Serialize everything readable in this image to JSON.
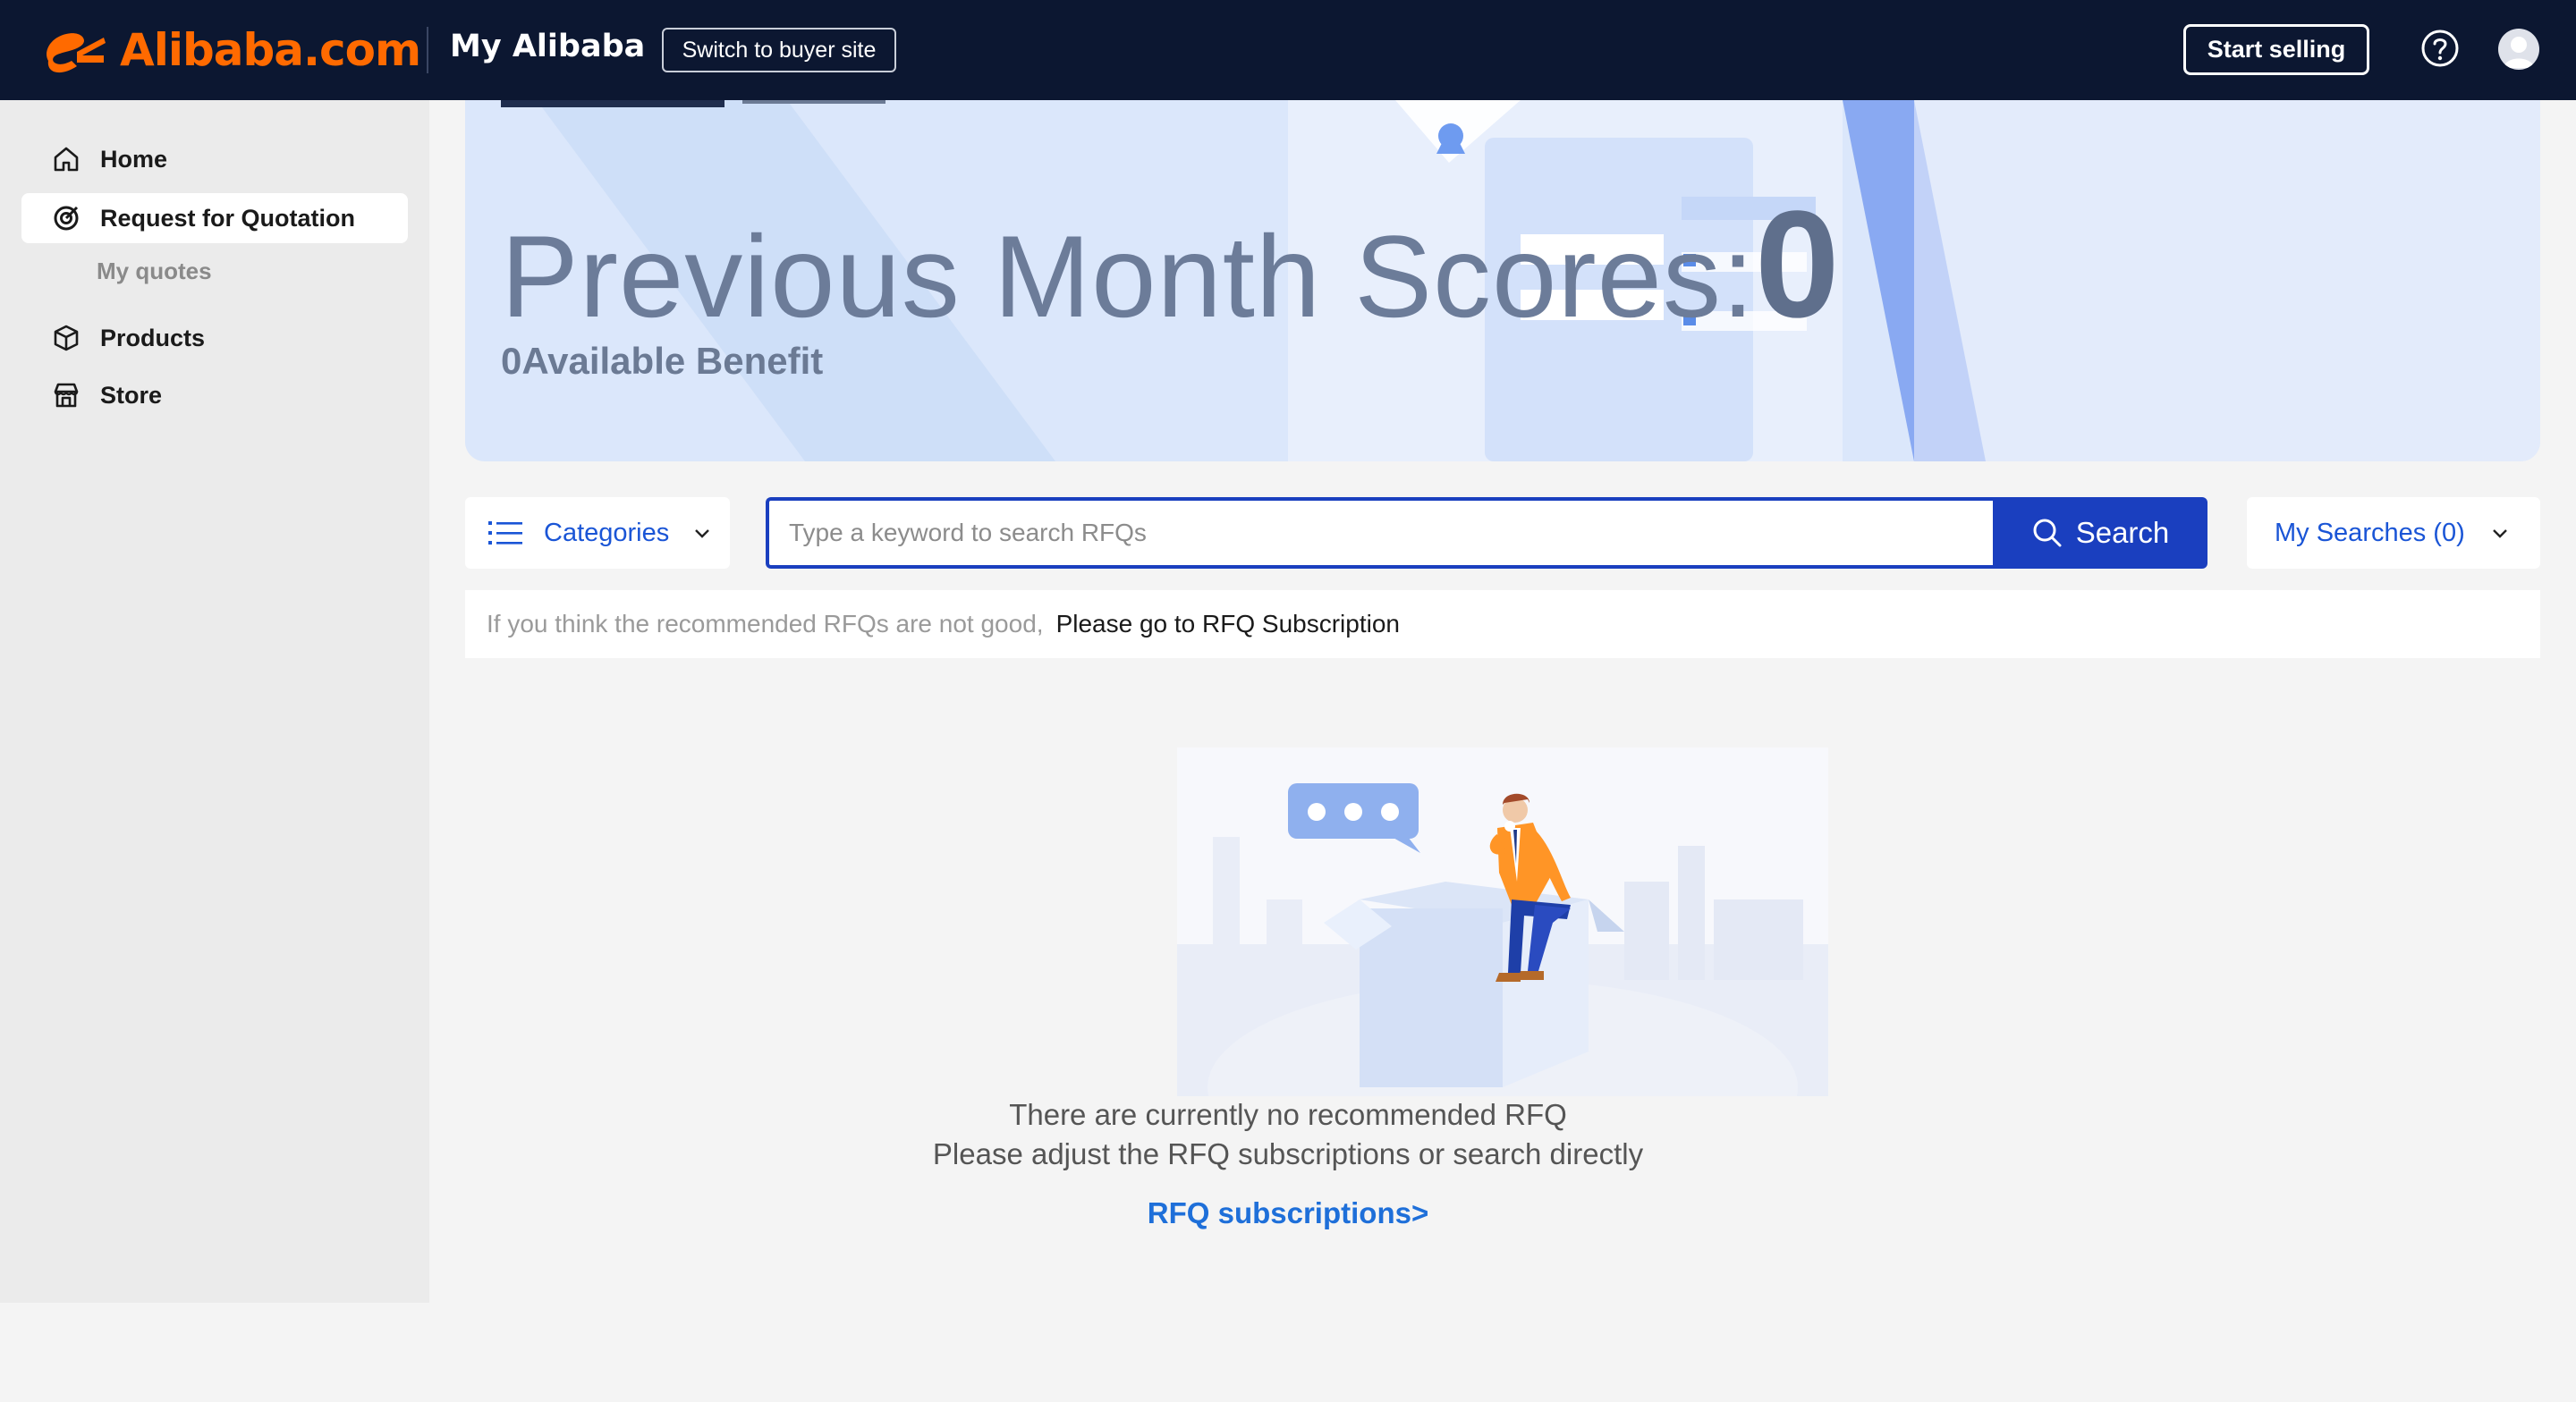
{
  "header": {
    "logo_text": "Alibaba.com",
    "title": "My Alibaba",
    "switch_label": "Switch to buyer site",
    "start_selling_label": "Start selling",
    "icons": [
      "alibaba-logo",
      "help-icon",
      "user-avatar"
    ]
  },
  "sidebar": {
    "items": [
      {
        "label": "Home",
        "icon": "home-icon"
      },
      {
        "label": "Request for Quotation",
        "icon": "target-icon",
        "active": true
      },
      {
        "label": "Products",
        "icon": "box-icon"
      },
      {
        "label": "Store",
        "icon": "store-icon"
      }
    ],
    "sub_item": "My quotes"
  },
  "banner": {
    "title": "Previous Month Scores:",
    "score": "0",
    "benefit": "0Available Benefit"
  },
  "search": {
    "categories_label": "Categories",
    "placeholder": "Type a keyword to search RFQs",
    "button_label": "Search",
    "my_searches_label": "My Searches (0)"
  },
  "hint": {
    "text": "If you think the recommended RFQs are not good,",
    "link": "Please go to RFQ Subscription"
  },
  "empty_state": {
    "line1": "There are currently no recommended RFQ",
    "line2": "Please adjust the RFQ subscriptions or search directly",
    "link": "RFQ subscriptions>"
  },
  "colors": {
    "topbar": "#0c1731",
    "brand_orange": "#ff6a00",
    "primary_blue": "#1a3fbf",
    "link_blue": "#1e6fd9"
  }
}
